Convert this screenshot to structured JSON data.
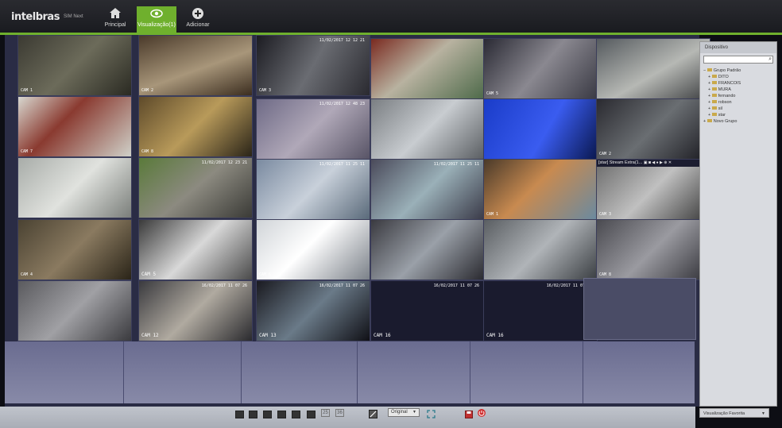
{
  "app": {
    "brand": "intelbras",
    "brand_sub": "SIM Next"
  },
  "nav": [
    {
      "label": "Principal",
      "icon": "home-icon"
    },
    {
      "label": "Visualização(1)",
      "icon": "eye-icon"
    },
    {
      "label": "Adicionar",
      "icon": "add-icon"
    }
  ],
  "cameras": {
    "r1": [
      "CAM 1",
      "CAM 2",
      "CAM 3",
      "",
      "CAM 5",
      ""
    ],
    "r2": [
      "CAM 7",
      "CAM 8",
      "",
      "",
      "",
      "CAM 2"
    ],
    "r3": [
      "",
      "",
      "",
      "",
      "CAM 1",
      "CAM 3"
    ],
    "r4": [
      "CAM 4",
      "CAM 5",
      "CAM 6",
      "",
      "",
      "CAM 8"
    ],
    "r5": [
      "",
      "CAM 12",
      "CAM 13",
      "CAM 16",
      "CAM 16",
      ""
    ]
  },
  "timestamps": {
    "r1c3": "11/02/2017 12 12 21",
    "r2c3": "11/02/2017 12 48 23",
    "r3c2": "11/02/2017 12 23 21",
    "r3c3": "11/02/2017 11 25 11",
    "r3c4": "11/02/2017 11 25 11",
    "r5c2": "16/02/2017 11 07 26",
    "r5c3": "16/02/2017 11 07 26",
    "r5c4": "16/02/2017 11 07 26",
    "r5c5": "16/02/2017 11 07 26"
  },
  "stream_label": "[star] Stream Extra(1...",
  "panel": {
    "title": "Dispositivo",
    "search_placeholder": "",
    "tree": [
      "Grupo Padrão",
      "DITO",
      "FRANCOIS",
      "MURA",
      "fernando",
      "robson",
      "sil",
      "star",
      "Novo Grupo"
    ]
  },
  "toolbar": {
    "layout_25": "25",
    "layout_36": "36",
    "aspect": "Original",
    "favorites": "Visualização Favorita"
  }
}
